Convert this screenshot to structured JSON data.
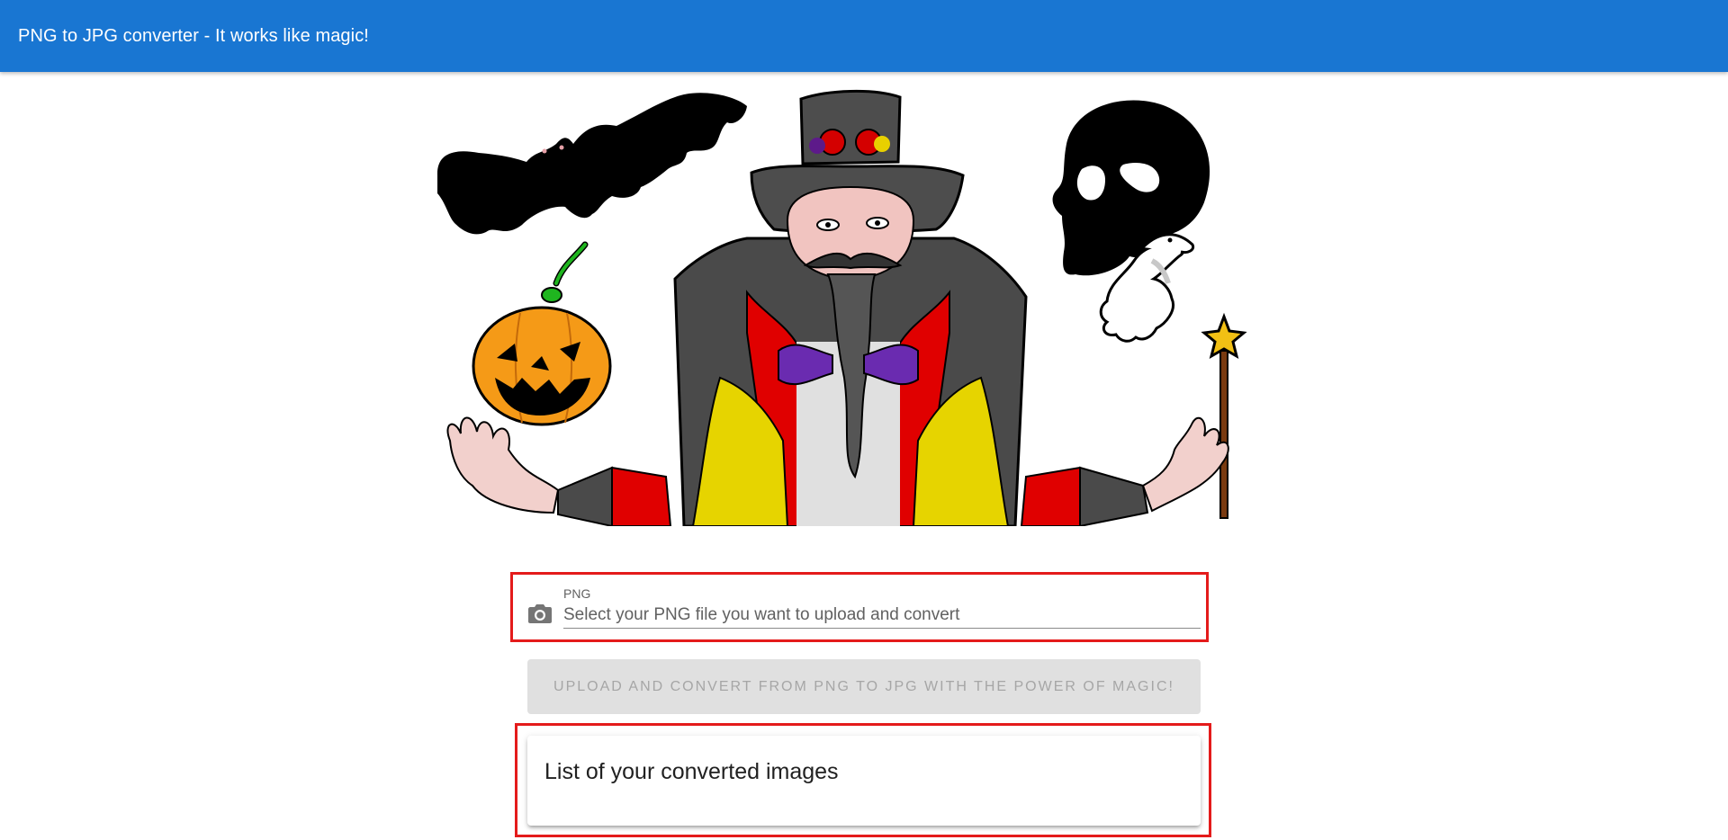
{
  "app_bar": {
    "title": "PNG to JPG converter - It works like magic!"
  },
  "hero": {
    "description": "magician with bat, pumpkin, skull, dove and wand"
  },
  "upload": {
    "label": "PNG",
    "placeholder": "Select your PNG file you want to upload and convert",
    "icon": "camera-icon"
  },
  "convert_button": {
    "label": "Upload and convert from PNG to JPG with the power of magic!",
    "disabled": true
  },
  "converted_list": {
    "title": "List of your converted images",
    "items": []
  },
  "colors": {
    "app_bar": "#1976d2",
    "highlight_frame": "#e41b1b",
    "disabled_button": "#e0e0e0"
  }
}
